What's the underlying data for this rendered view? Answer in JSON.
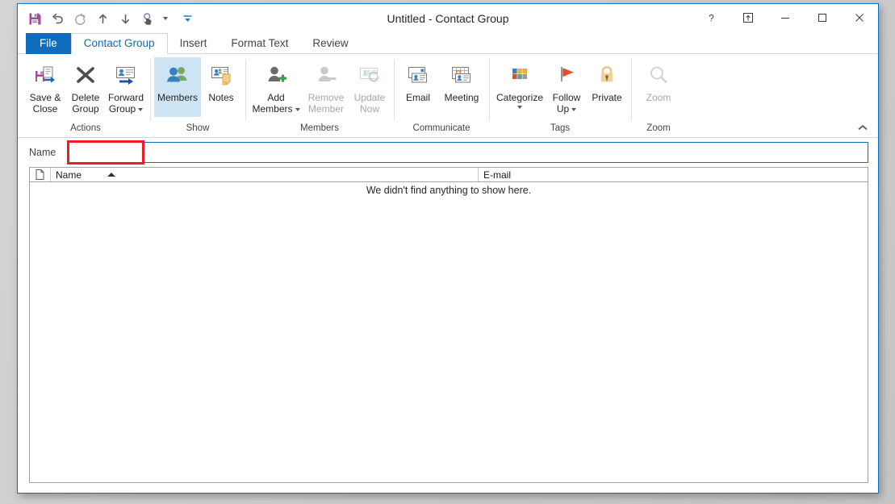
{
  "window": {
    "title": "Untitled - Contact Group"
  },
  "quick_access": {
    "items": [
      {
        "name": "save-icon",
        "label": "Save"
      },
      {
        "name": "undo-icon",
        "label": "Undo"
      },
      {
        "name": "redo-icon",
        "label": "Redo"
      },
      {
        "name": "previous-item-icon",
        "label": "Previous Item"
      },
      {
        "name": "next-item-icon",
        "label": "Next Item"
      },
      {
        "name": "touch-mouse-mode-icon",
        "label": "Touch/Mouse Mode"
      },
      {
        "name": "customize-quick-access-toolbar-icon",
        "label": "Customize Quick Access Toolbar"
      }
    ]
  },
  "window_controls": {
    "help": "?",
    "ribbon_display_options": "Ribbon Display Options",
    "minimize": "—",
    "maximize": "☐",
    "close": "✕"
  },
  "tabs": {
    "file": "File",
    "items": [
      {
        "label": "Contact Group",
        "active": true
      },
      {
        "label": "Insert",
        "active": false
      },
      {
        "label": "Format Text",
        "active": false
      },
      {
        "label": "Review",
        "active": false
      }
    ]
  },
  "ribbon": {
    "collapse_tooltip": "Collapse the Ribbon",
    "groups": [
      {
        "label": "Actions",
        "buttons": [
          {
            "label": "Save & Close",
            "icon": "save-and-close-icon",
            "state": "enabled",
            "dropdown": false
          },
          {
            "label": "Delete Group",
            "icon": "delete-group-icon",
            "state": "enabled",
            "dropdown": false
          },
          {
            "label": "Forward Group",
            "icon": "forward-group-icon",
            "state": "enabled",
            "dropdown": true
          }
        ]
      },
      {
        "label": "Show",
        "buttons": [
          {
            "label": "Members",
            "icon": "members-icon",
            "state": "selected",
            "dropdown": false
          },
          {
            "label": "Notes",
            "icon": "notes-icon",
            "state": "enabled",
            "dropdown": false
          }
        ]
      },
      {
        "label": "Members",
        "buttons": [
          {
            "label": "Add Members",
            "icon": "add-members-icon",
            "state": "enabled",
            "dropdown": true
          },
          {
            "label": "Remove Member",
            "icon": "remove-member-icon",
            "state": "disabled",
            "dropdown": false
          },
          {
            "label": "Update Now",
            "icon": "update-now-icon",
            "state": "disabled",
            "dropdown": false
          }
        ]
      },
      {
        "label": "Communicate",
        "buttons": [
          {
            "label": "Email",
            "icon": "email-icon",
            "state": "enabled",
            "dropdown": false
          },
          {
            "label": "Meeting",
            "icon": "meeting-icon",
            "state": "enabled",
            "dropdown": false
          }
        ]
      },
      {
        "label": "Tags",
        "buttons": [
          {
            "label": "Categorize",
            "icon": "categorize-icon",
            "state": "enabled",
            "dropdown": true
          },
          {
            "label": "Follow Up",
            "icon": "follow-up-flag-icon",
            "state": "enabled",
            "dropdown": true
          },
          {
            "label": "Private",
            "icon": "private-lock-icon",
            "state": "enabled",
            "dropdown": false
          }
        ]
      },
      {
        "label": "Zoom",
        "buttons": [
          {
            "label": "Zoom",
            "icon": "zoom-magnifier-icon",
            "state": "disabled",
            "dropdown": false
          }
        ]
      }
    ]
  },
  "form": {
    "name_label": "Name",
    "name_value": "",
    "name_placeholder": "",
    "highlight_color": "#ee1c25"
  },
  "member_list": {
    "columns": [
      {
        "key": "icon",
        "label": ""
      },
      {
        "key": "name",
        "label": "Name",
        "sort": "ascending"
      },
      {
        "key": "email",
        "label": "E-mail"
      }
    ],
    "rows": [],
    "empty_message": "We didn't find anything to show here."
  },
  "colors": {
    "accent": "#0f6cbd",
    "file_tab": "#0f6cbd",
    "selected_button": "#cce4f4",
    "annotation": "#ee1c25",
    "disabled_text": "#a6a6a6"
  }
}
